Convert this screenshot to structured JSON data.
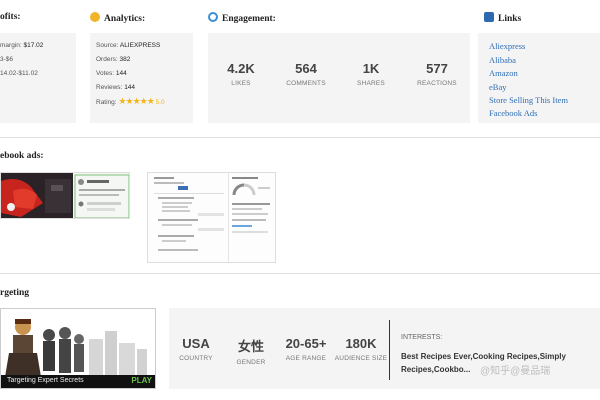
{
  "profits": {
    "title": "ofits:",
    "margin_label": "margin:",
    "margin_value": "$17.02",
    "line2": "3-$6",
    "line3": "14.02-$11.02"
  },
  "analytics": {
    "title": "Analytics:",
    "source_label": "Source:",
    "source_value": "ALIEXPRESS",
    "orders_label": "Orders:",
    "orders_value": "382",
    "votes_label": "Votes:",
    "votes_value": "144",
    "reviews_label": "Reviews:",
    "reviews_value": "144",
    "rating_label": "Rating:",
    "rating_value": "5.0",
    "rating_stars": 5
  },
  "engagement": {
    "title": "Engagement:",
    "stats": [
      {
        "value": "4.2K",
        "label": "LIKES"
      },
      {
        "value": "564",
        "label": "COMMENTS"
      },
      {
        "value": "1K",
        "label": "SHARES"
      },
      {
        "value": "577",
        "label": "REACTIONS"
      }
    ]
  },
  "links": {
    "title": "Links",
    "items": [
      "Aliexpress",
      "Alibaba",
      "Amazon",
      "eBay",
      "Store Selling This Item",
      "Facebook Ads"
    ]
  },
  "facebook_ads": {
    "title": "ebook ads:"
  },
  "targeting": {
    "title": "rgeting",
    "video_caption": "Targeting Expert Secrets",
    "play_label": "PLAY",
    "stats": [
      {
        "value": "USA",
        "label": "COUNTRY"
      },
      {
        "value": "女性",
        "label": "GENDER"
      },
      {
        "value": "20-65+",
        "label": "AGE RANGE"
      },
      {
        "value": "180K",
        "label": "AUDIENCE SIZE"
      }
    ],
    "interests_label": "INTERESTS:",
    "interests_value": "Best Recipes Ever,Cooking Recipes,Simply Recipes,Cookbo..."
  },
  "watermark": "@知乎@曼品瑞",
  "colors": {
    "analytics_badge": "#f0b429",
    "engagement_badge": "#3b8fd6",
    "links_badge": "#2d6ab0",
    "link_text": "#2e6fb4",
    "play_green": "#6cc24a",
    "star": "#f3b51b"
  }
}
